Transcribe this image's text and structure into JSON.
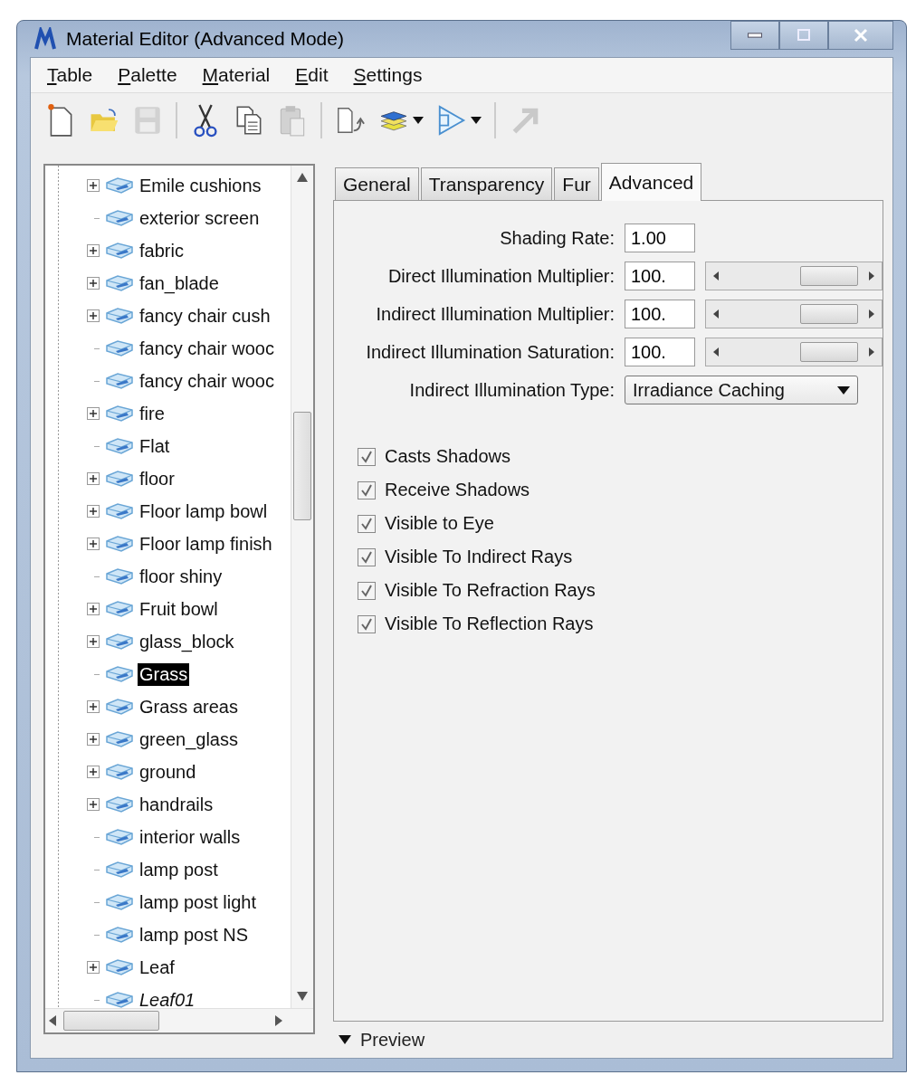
{
  "window": {
    "title": "Material Editor (Advanced Mode)"
  },
  "menu": [
    {
      "label": "Table"
    },
    {
      "label": "Palette"
    },
    {
      "label": "Material"
    },
    {
      "label": "Edit"
    },
    {
      "label": "Settings"
    }
  ],
  "toolbar": [
    {
      "kind": "new",
      "disabled": false
    },
    {
      "kind": "open",
      "disabled": false
    },
    {
      "kind": "save",
      "disabled": true
    },
    {
      "kind": "sep"
    },
    {
      "kind": "cut",
      "disabled": false
    },
    {
      "kind": "copy",
      "disabled": false
    },
    {
      "kind": "paste",
      "disabled": true
    },
    {
      "kind": "sep"
    },
    {
      "kind": "import",
      "disabled": false
    },
    {
      "kind": "layers",
      "disabled": false
    },
    {
      "kind": "drop"
    },
    {
      "kind": "funnel",
      "disabled": false
    },
    {
      "kind": "drop"
    },
    {
      "kind": "sep"
    },
    {
      "kind": "export",
      "disabled": true
    }
  ],
  "tree": [
    {
      "label": "Emile cushions",
      "expandable": true,
      "selected": false,
      "italic": false
    },
    {
      "label": "exterior screen",
      "expandable": false,
      "selected": false,
      "italic": false
    },
    {
      "label": "fabric",
      "expandable": true,
      "selected": false,
      "italic": false
    },
    {
      "label": "fan_blade",
      "expandable": true,
      "selected": false,
      "italic": false
    },
    {
      "label": "fancy chair cush",
      "expandable": true,
      "selected": false,
      "italic": false
    },
    {
      "label": "fancy chair wooc",
      "expandable": false,
      "selected": false,
      "italic": false
    },
    {
      "label": "fancy chair wooc",
      "expandable": false,
      "selected": false,
      "italic": false
    },
    {
      "label": "fire",
      "expandable": true,
      "selected": false,
      "italic": false
    },
    {
      "label": "Flat",
      "expandable": false,
      "selected": false,
      "italic": false
    },
    {
      "label": "floor",
      "expandable": true,
      "selected": false,
      "italic": false
    },
    {
      "label": "Floor lamp bowl",
      "expandable": true,
      "selected": false,
      "italic": false
    },
    {
      "label": "Floor lamp finish",
      "expandable": true,
      "selected": false,
      "italic": false
    },
    {
      "label": "floor shiny",
      "expandable": false,
      "selected": false,
      "italic": false
    },
    {
      "label": "Fruit bowl",
      "expandable": true,
      "selected": false,
      "italic": false
    },
    {
      "label": "glass_block",
      "expandable": true,
      "selected": false,
      "italic": false
    },
    {
      "label": "Grass",
      "expandable": false,
      "selected": true,
      "italic": false
    },
    {
      "label": "Grass areas",
      "expandable": true,
      "selected": false,
      "italic": false
    },
    {
      "label": "green_glass",
      "expandable": true,
      "selected": false,
      "italic": false
    },
    {
      "label": "ground",
      "expandable": true,
      "selected": false,
      "italic": false
    },
    {
      "label": "handrails",
      "expandable": true,
      "selected": false,
      "italic": false
    },
    {
      "label": "interior walls",
      "expandable": false,
      "selected": false,
      "italic": false
    },
    {
      "label": "lamp post",
      "expandable": false,
      "selected": false,
      "italic": false
    },
    {
      "label": "lamp post light",
      "expandable": false,
      "selected": false,
      "italic": false
    },
    {
      "label": "lamp post NS",
      "expandable": false,
      "selected": false,
      "italic": false
    },
    {
      "label": "Leaf",
      "expandable": true,
      "selected": false,
      "italic": false
    },
    {
      "label": "Leaf01",
      "expandable": false,
      "selected": false,
      "italic": true
    }
  ],
  "tabs": [
    {
      "label": "General",
      "selected": false
    },
    {
      "label": "Transparency",
      "selected": false
    },
    {
      "label": "Fur",
      "selected": false
    },
    {
      "label": "Advanced",
      "selected": true
    }
  ],
  "fields": [
    {
      "kind": "text",
      "label": "Shading Rate:",
      "value": "1.00"
    },
    {
      "kind": "slider",
      "label": "Direct Illumination Multiplier:",
      "value": "100."
    },
    {
      "kind": "slider",
      "label": "Indirect Illumination Multiplier:",
      "value": "100."
    },
    {
      "kind": "slider",
      "label": "Indirect Illumination Saturation:",
      "value": "100."
    },
    {
      "kind": "dropdown",
      "label": "Indirect Illumination Type:",
      "value": "Irradiance Caching"
    }
  ],
  "checkboxes": [
    {
      "label": "Casts Shadows",
      "checked": true
    },
    {
      "label": "Receive Shadows",
      "checked": true
    },
    {
      "label": "Visible to Eye",
      "checked": true
    },
    {
      "label": "Visible To Indirect Rays",
      "checked": true
    },
    {
      "label": "Visible To Refraction Rays",
      "checked": true
    },
    {
      "label": "Visible To Reflection Rays",
      "checked": true
    }
  ],
  "preview": {
    "label": "Preview",
    "expanded": false
  }
}
